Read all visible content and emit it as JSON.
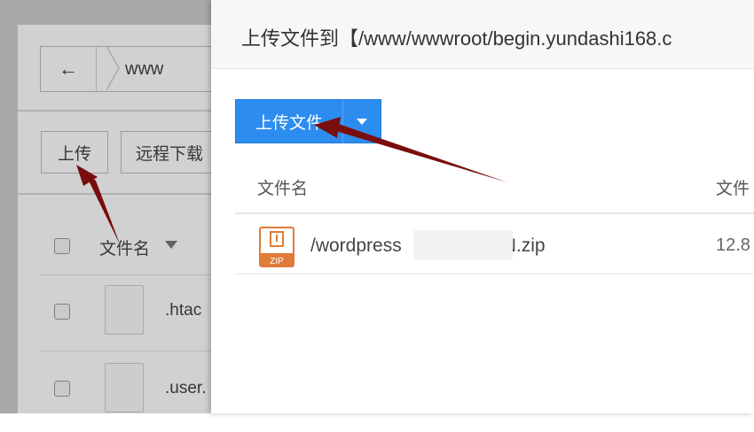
{
  "background": {
    "back_icon": "arrow-left-icon",
    "breadcrumb": "www",
    "upload_label": "上传",
    "remote_download_label": "远程下载",
    "column_filename": "文件名",
    "files": [
      ".htac",
      ".user."
    ]
  },
  "dialog": {
    "title": "上传文件到【/www/wwwroot/begin.yundashi168.c",
    "upload_button_label": "上传文件",
    "columns": {
      "name": "文件名",
      "size": "文件"
    },
    "rows": [
      {
        "name_prefix": "/wordpress",
        "name_suffix": "N.zip",
        "size": "12.8",
        "icon": "zip-file-icon",
        "icon_text": "ZIP"
      }
    ]
  },
  "colors": {
    "primary": "#2d8cf0",
    "arrow": "#7a0d0d"
  }
}
